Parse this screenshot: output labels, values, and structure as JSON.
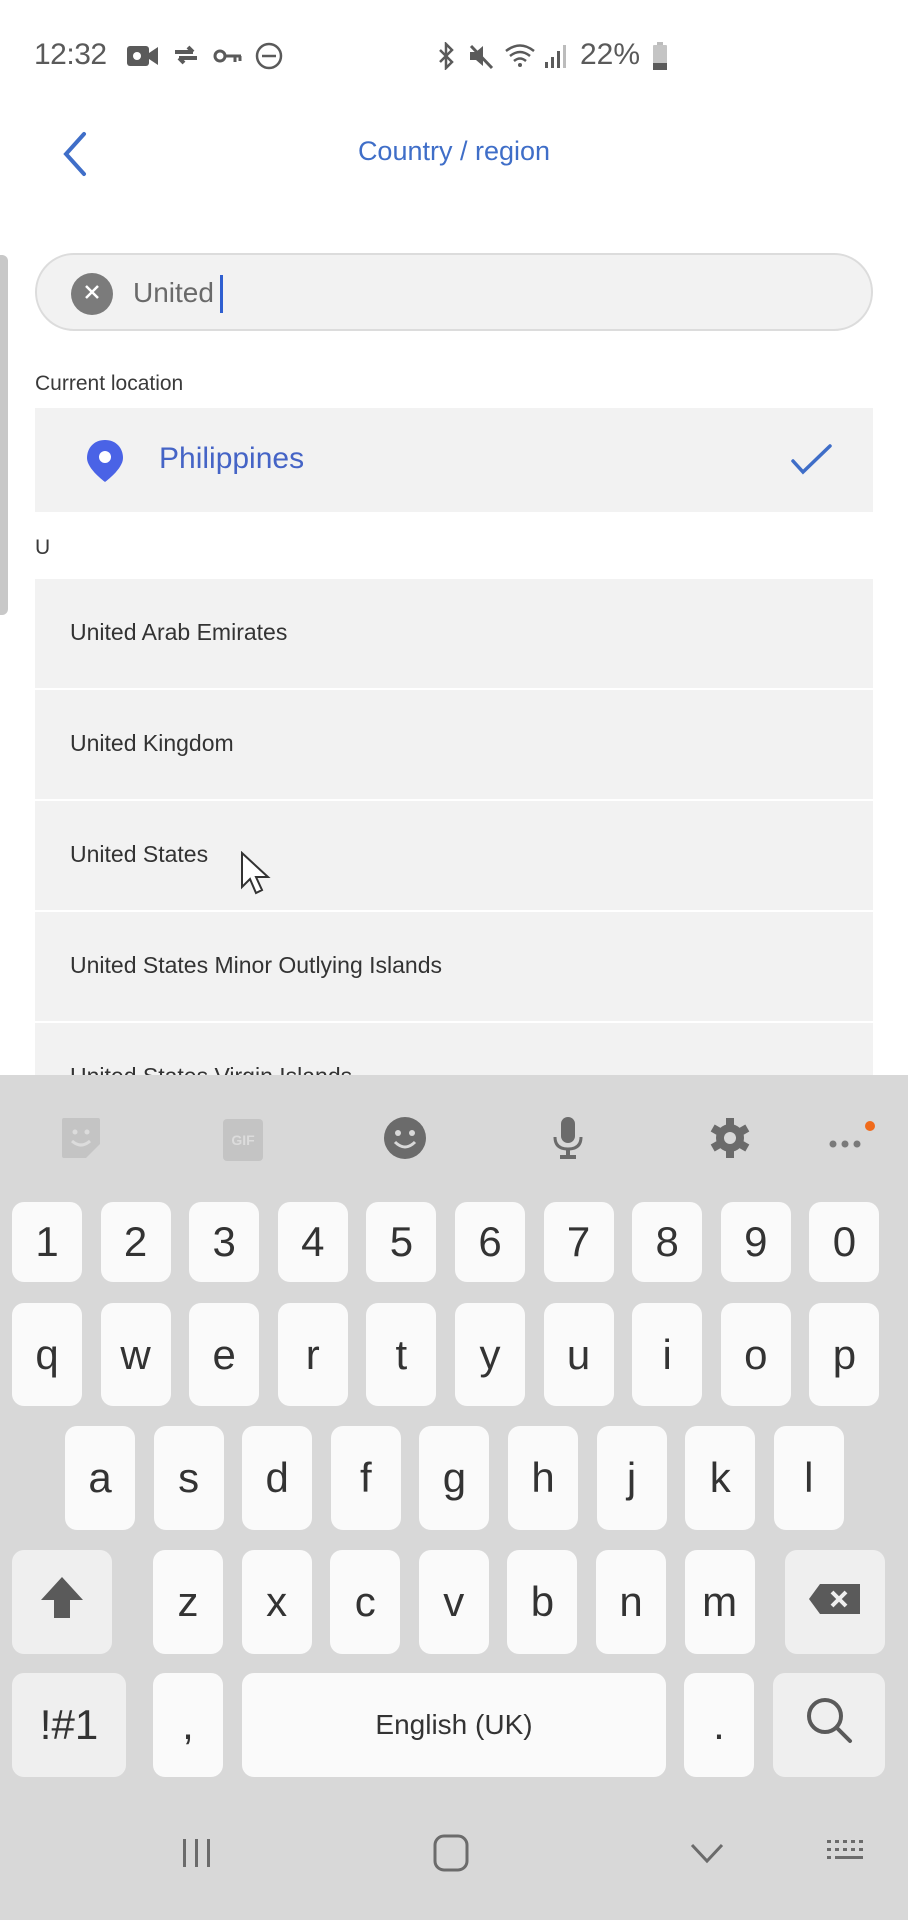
{
  "status_bar": {
    "time": "12:32",
    "left_icons": [
      "video-record-icon",
      "sync-icon",
      "vpn-key-icon",
      "do-not-disturb-icon"
    ],
    "right_icons": [
      "bluetooth-icon",
      "mute-icon",
      "wifi-icon",
      "signal-icon",
      "battery-icon"
    ],
    "battery_percent": "22%"
  },
  "header": {
    "title": "Country / region",
    "back_icon": "chevron-left-icon"
  },
  "search": {
    "value": "United",
    "clear_icon": "close-icon"
  },
  "current_location": {
    "label": "Current location",
    "country": "Philippines",
    "selected": true
  },
  "list": {
    "section_letter": "U",
    "items": [
      {
        "label": "United Arab Emirates"
      },
      {
        "label": "United Kingdom"
      },
      {
        "label": "United States"
      },
      {
        "label": "United States Minor Outlying Islands"
      },
      {
        "label": "United States Virgin Islands"
      }
    ]
  },
  "keyboard": {
    "toolbar": [
      "sticker-icon",
      "gif-icon",
      "emoji-icon",
      "microphone-icon",
      "settings-icon",
      "more-icon"
    ],
    "gif_label": "GIF",
    "notification_color": "#f06a1b",
    "rows": [
      [
        "1",
        "2",
        "3",
        "4",
        "5",
        "6",
        "7",
        "8",
        "9",
        "0"
      ],
      [
        "q",
        "w",
        "e",
        "r",
        "t",
        "y",
        "u",
        "i",
        "o",
        "p"
      ],
      [
        "a",
        "s",
        "d",
        "f",
        "g",
        "h",
        "j",
        "k",
        "l"
      ],
      [
        "z",
        "x",
        "c",
        "v",
        "b",
        "n",
        "m"
      ]
    ],
    "symbols_label": "!#1",
    "comma_label": ",",
    "space_label": "English (UK)",
    "period_label": "."
  },
  "nav_bar": [
    "recent-apps-icon",
    "home-icon",
    "hide-keyboard-icon",
    "keyboard-switch-icon"
  ],
  "colors": {
    "accent": "#3f6ec8",
    "pin": "#4a63e6",
    "card_bg": "#f2f2f2",
    "keyboard_bg": "#d8d8d8"
  }
}
